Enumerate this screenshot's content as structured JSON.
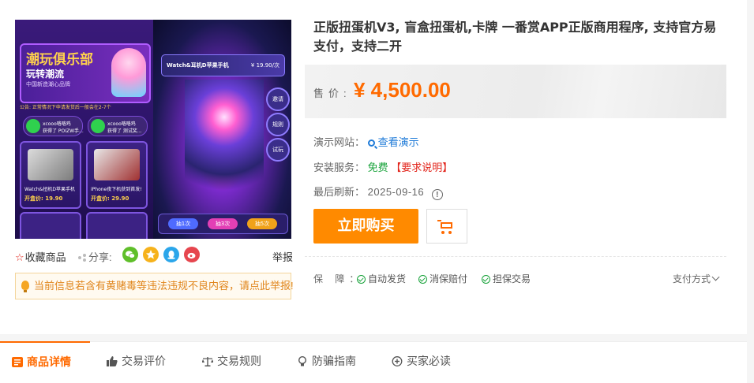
{
  "product": {
    "title": "正版扭蛋机V3, 盲盒扭蛋机,卡牌 一番赏APP正版商用程序, 支持官方易支付，支持二开",
    "image": {
      "banner_title": "潮玩俱乐部",
      "banner_sub": "玩转潮流",
      "banner_sub2": "中国新造潮心品牌",
      "notice": "公告: 正常情况下申请发货后一般会在2-7个",
      "winners": [
        {
          "name": "xcooo咯咯鸡",
          "desc": "获得了 POIZW手..."
        },
        {
          "name": "xcooo咯咯鸡",
          "desc": "获得了 测试奖..."
        }
      ],
      "items": [
        {
          "name": "Watch&扭机D苹果手机",
          "price": "开盒价: 19.90"
        },
        {
          "name": "iPhone夜下机获到首发!",
          "price": "开盒价: 29.90"
        }
      ],
      "prize_name": "Watch&耳机D苹果手机",
      "prize_price": "¥ 19.90/次",
      "side_buttons": [
        "邀请",
        "规则",
        "试玩"
      ],
      "draws": [
        "抽1次",
        "抽3次",
        "抽5次"
      ]
    }
  },
  "actions": {
    "favorite": "收藏商品",
    "share": "分享:",
    "report": "举报"
  },
  "warning": "当前信息若含有黄赌毒等违法违规不良内容，请点此举报!",
  "price": {
    "label": "售价:",
    "value": "¥ 4,500.00"
  },
  "details": {
    "demo_label": "演示网站：",
    "demo_link": "查看演示",
    "install_label": "安装服务：",
    "install_value": "免费",
    "install_note": "【要求说明】",
    "refresh_label": "最后刷新：",
    "refresh_date": "2025-09-16"
  },
  "buttons": {
    "buy": "立即购买"
  },
  "guarantee": {
    "label": "保 障：",
    "items": [
      "自动发货",
      "消保赔付",
      "担保交易"
    ],
    "pay_method": "支付方式"
  },
  "tabs": [
    "商品详情",
    "交易评价",
    "交易规则",
    "防骗指南",
    "买家必读"
  ],
  "colors": {
    "accent": "#ff6a00",
    "buy_button": "#ff8a00",
    "link": "#1f7bd8",
    "free": "#19a33b",
    "required": "#e2231a"
  }
}
